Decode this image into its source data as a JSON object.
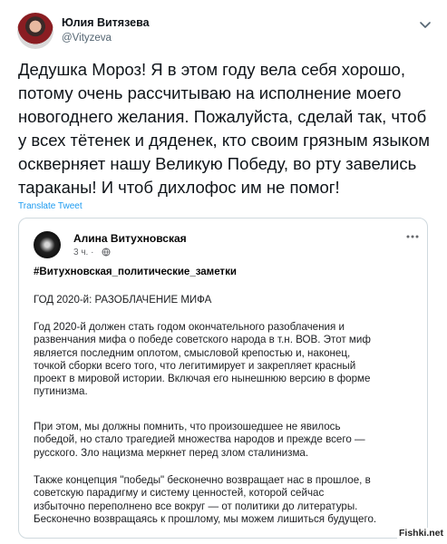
{
  "tweet": {
    "author_name": "Юлия Витязева",
    "author_handle": "@Vityzeva",
    "text": "Дедушка Мороз! Я в этом году вела себя хорошо,\nпотому очень рассчитываю на исполнение моего\nновогоднего желания. Пожалуйста, сделай так, чтоб\nу всех тётенек и дяденек, кто своим грязным языком\nоскверняет нашу Великую Победу, во рту завелись\nтараканы! И чтоб дихлофос им не помог!",
    "translate_label": "Translate Tweet"
  },
  "quoted_post": {
    "author_name": "Алина Витухновская",
    "time": "3 ч. ·",
    "hashtag": "#Витухновская_политические_заметки",
    "heading": "ГОД 2020-й: РАЗОБЛАЧЕНИЕ МИФА",
    "paragraph1": "Год 2020-й должен стать годом окончательного разоблачения и\nразвенчания мифа о победе советского народа в т.н. ВОВ. Этот миф\nявляется последним оплотом, смысловой крепостью и, наконец,\nточкой сборки всего того, что легитимирует и закрепляет красный\nпроект в мировой истории. Включая его нынешнюю версию в форме\nпутинизма.",
    "paragraph2": "При этом, мы должны помнить, что произошедшее не явилось\nпобедой, но стало трагедией множества народов и прежде всего —\nрусского. Зло нацизма меркнет перед злом сталинизма.",
    "paragraph3": "Также концепция \"победы\" бесконечно возвращает нас в прошлое, в\nсоветскую парадигму и систему ценностей, которой сейчас\nизбыточно переполнено все вокруг — от политики до литературы.\nБесконечно возвращаясь к прошлому, мы можем лишиться будущего."
  },
  "watermark": "Fishki.net",
  "colors": {
    "text": "#0f1419",
    "secondary": "#536471",
    "link": "#1d9bf0",
    "border": "#cfd9de"
  },
  "icons": {
    "tweet_more": "chevron-down-icon",
    "quote_more": "more-horizontal-icon",
    "privacy": "globe-icon"
  }
}
